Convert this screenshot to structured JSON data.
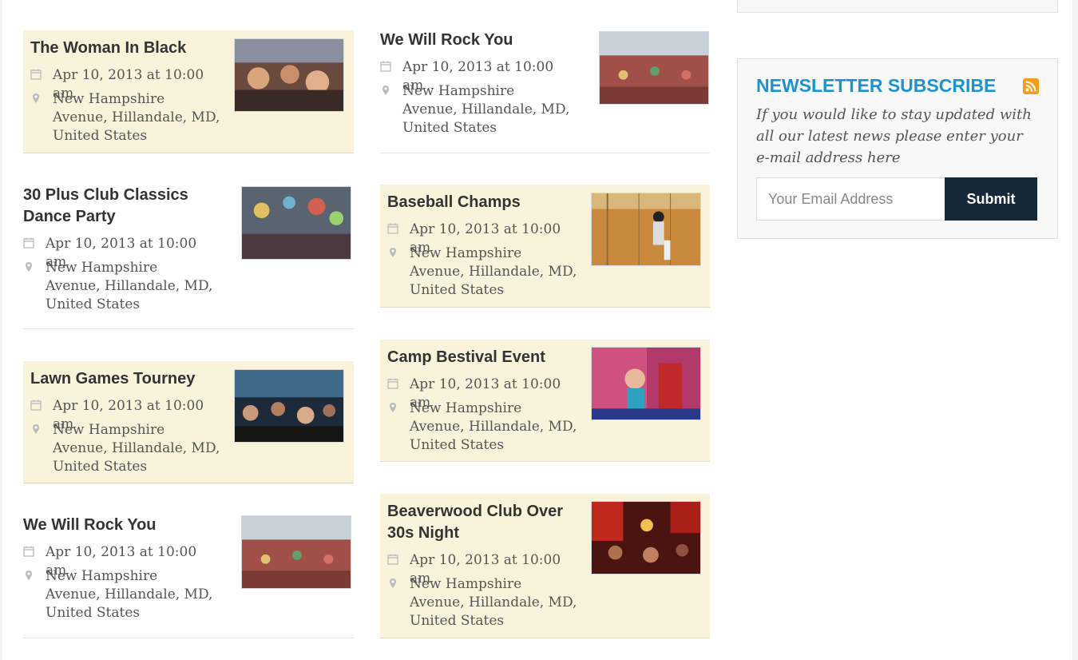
{
  "events_left": [
    {
      "title": "The Woman In Black",
      "date": "Apr 10, 2013 at 10:00 am",
      "location": "New Hampshire Avenue, Hillandale, MD, United States"
    },
    {
      "title": "30 Plus Club Classics Dance Party",
      "date": "Apr 10, 2013 at 10:00 am",
      "location": "New Hampshire Avenue, Hillandale, MD, United States"
    },
    {
      "title": "Lawn Games Tourney",
      "date": "Apr 10, 2013 at 10:00 am",
      "location": "New Hampshire Avenue, Hillandale, MD, United States"
    },
    {
      "title": "We Will Rock You",
      "date": "Apr 10, 2013 at 10:00 am",
      "location": "New Hampshire Avenue, Hillandale, MD, United States"
    }
  ],
  "events_mid": [
    {
      "title": "We Will Rock You",
      "date": "Apr 10, 2013 at 10:00 am",
      "location": "New Hampshire Avenue, Hillandale, MD, United States"
    },
    {
      "title": "Baseball Champs",
      "date": "Apr 10, 2013 at 10:00 am",
      "location": "New Hampshire Avenue, Hillandale, MD, United States"
    },
    {
      "title": "Camp Bestival Event",
      "date": "Apr 10, 2013 at 10:00 am",
      "location": "New Hampshire Avenue, Hillandale, MD, United States"
    },
    {
      "title": "Beaverwood Club Over 30s Night",
      "date": "Apr 10, 2013 at 10:00 am",
      "location": "New Hampshire Avenue, Hillandale, MD, United States"
    }
  ],
  "newsletter": {
    "title": "NEWSLETTER SUBSCRIBE",
    "description": "If you would like to stay updated with all our latest news please enter your e-mail address here",
    "email_placeholder": "Your Email Address",
    "submit_label": "Submit",
    "rss_icon": "rss-icon"
  },
  "icons": {
    "date": "calendar-icon",
    "location": "map-pin-icon"
  },
  "colors": {
    "highlight_bg": "#faf3dc",
    "accent": "#1a93cf",
    "button": "#16283a",
    "rss": "#f39d1a"
  }
}
